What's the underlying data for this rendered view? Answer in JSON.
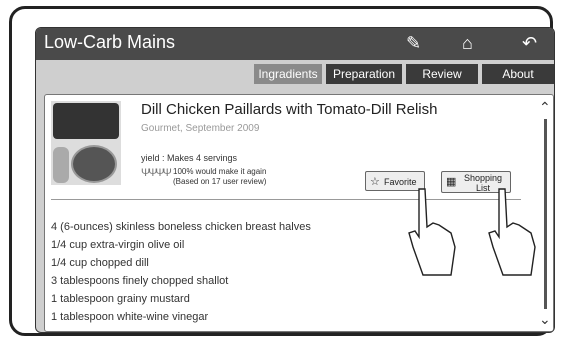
{
  "app_title": "Low-Carb Mains",
  "toolbar": {
    "bookmark_icon": "bookmark-icon",
    "home_icon": "home-icon",
    "back_icon": "back-icon"
  },
  "tabs": [
    {
      "label": "Ingradients",
      "active": true
    },
    {
      "label": "Preparation",
      "active": false
    },
    {
      "label": "Review",
      "active": false
    },
    {
      "label": "About",
      "active": false
    }
  ],
  "recipe": {
    "title": "Dill Chicken Paillards with Tomato-Dill Relish",
    "source": "Gourmet, September 2009",
    "yield": "yield : Makes 4 servings",
    "rating_line1": "100% would make it again",
    "rating_line2": "(Based on 17 user review)"
  },
  "buttons": {
    "favorite": "Favorite",
    "shopping_line1": "Shopping",
    "shopping_line2": "List"
  },
  "ingredients": [
    "4 (6-ounces) skinless boneless chicken breast halves",
    "1/4 cup extra-virgin olive oil",
    "1/4 cup chopped dill",
    "3 tablespoons finely chopped shallot",
    "1 tablespoon grainy mustard",
    "1 tablespoon white-wine vinegar"
  ],
  "colors": {
    "title_bar": "#4a4a4a",
    "active_tab": "#8a8a8a",
    "inactive_tab": "#3a3a3a"
  }
}
